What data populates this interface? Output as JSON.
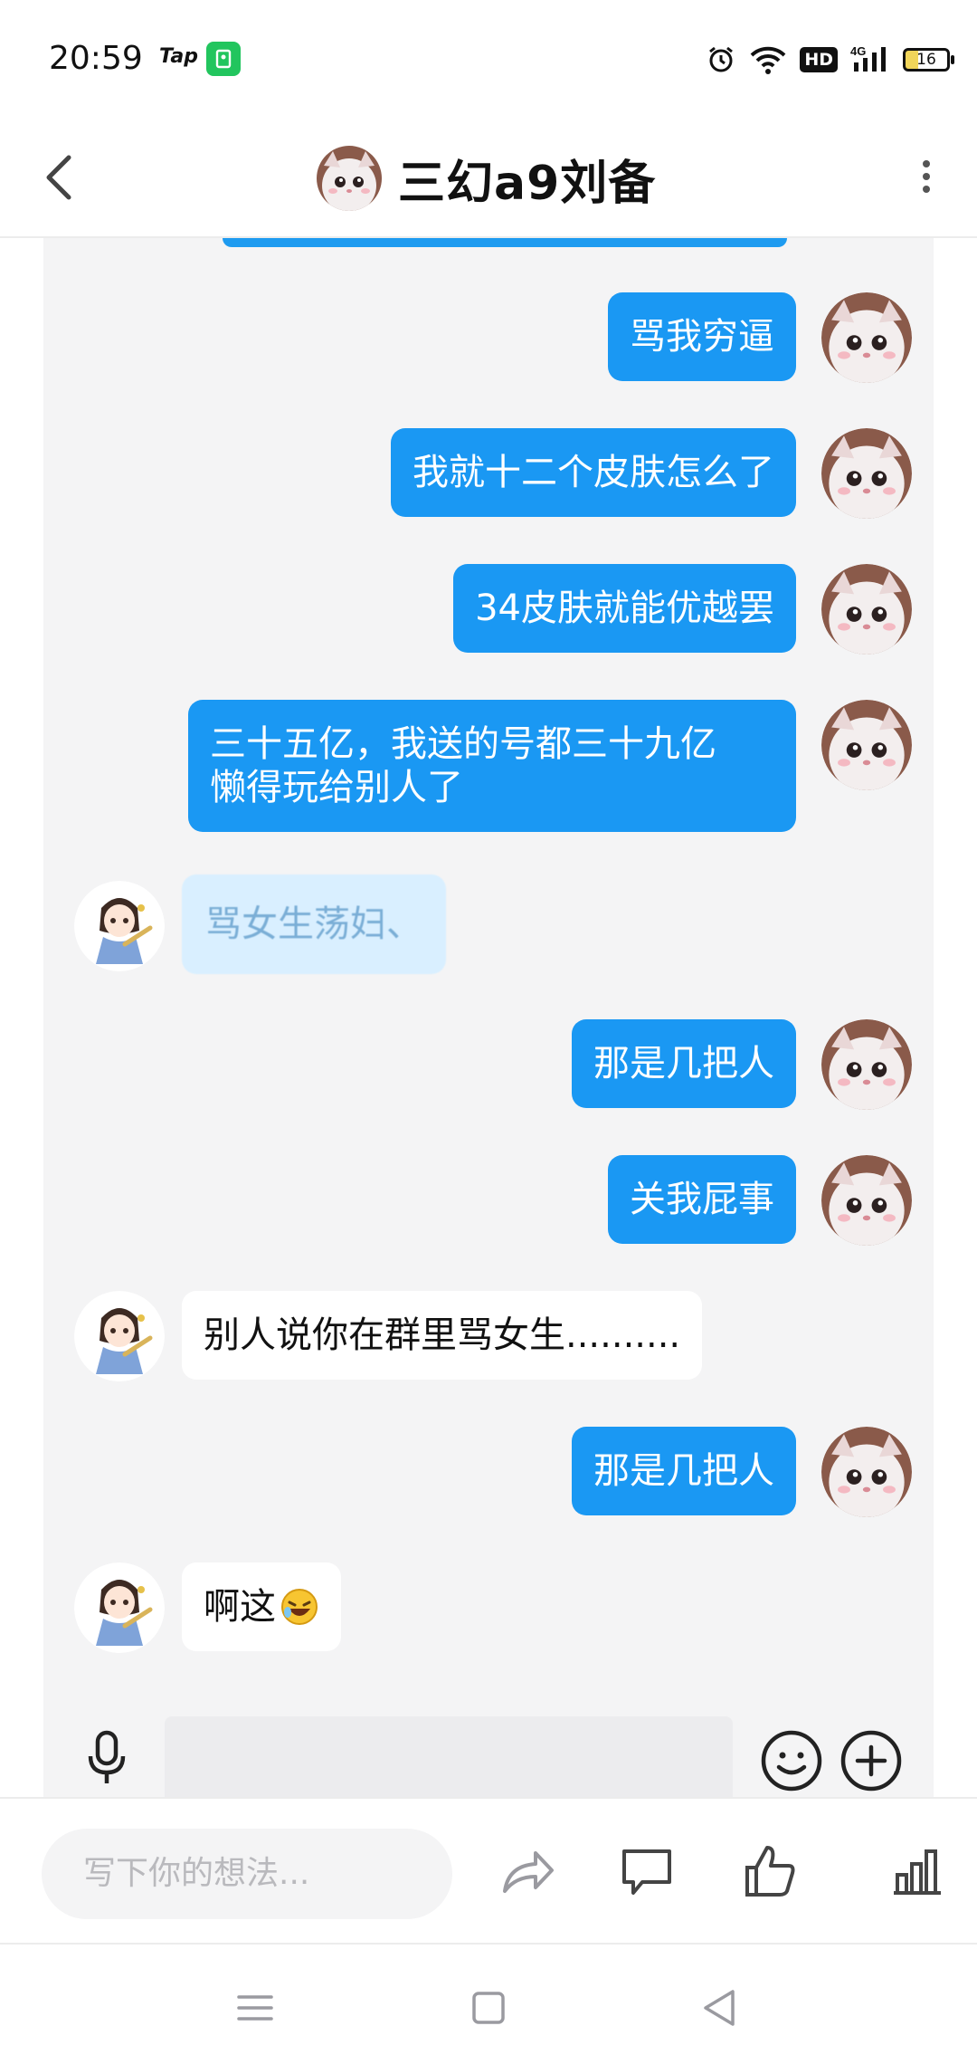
{
  "status_bar": {
    "time": "20:59",
    "tap_label": "Tap",
    "hd_label": "HD",
    "network_label": "4G",
    "battery_level": "16"
  },
  "header": {
    "title": "三幻a9刘备"
  },
  "messages": [
    {
      "side": "out",
      "text": "骂我穷逼"
    },
    {
      "side": "out",
      "text": "我就十二个皮肤怎么了"
    },
    {
      "side": "out",
      "text": "34皮肤就能优越罢"
    },
    {
      "side": "out",
      "text": "三十五亿，我送的号都三十九亿\n懒得玩给别人了"
    },
    {
      "side": "in",
      "text": "骂女生荡妇、"
    },
    {
      "side": "out",
      "text": "那是几把人"
    },
    {
      "side": "out",
      "text": "关我屁事"
    },
    {
      "side": "in",
      "text": "别人说你在群里骂女生.........."
    },
    {
      "side": "out",
      "text": "那是几把人"
    },
    {
      "side": "in",
      "text": "啊这"
    }
  ],
  "comment_bar": {
    "placeholder": "写下你的想法..."
  },
  "icons": {
    "back": "back-arrow-icon",
    "more": "more-vertical-icon",
    "mic": "microphone-icon",
    "emoji": "smiley-icon",
    "plus": "plus-circle-icon",
    "share": "share-icon",
    "comment": "comment-icon",
    "like": "thumbs-up-icon",
    "stats": "bar-chart-icon",
    "nav_menu": "menu-icon",
    "nav_home": "square-home-icon",
    "nav_back": "triangle-back-icon"
  },
  "colors": {
    "outgoing_bubble": "#1a98f3",
    "chat_background": "#f4f4f5",
    "incoming_bubble": "#ffffff"
  }
}
